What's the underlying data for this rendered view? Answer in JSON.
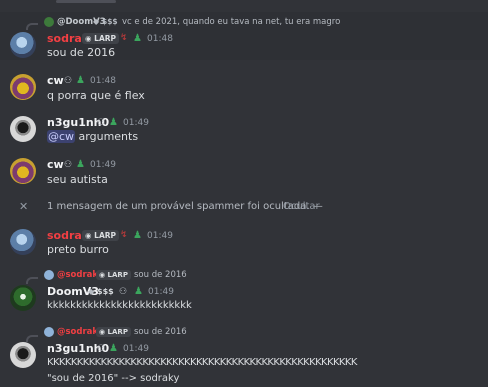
{
  "colors": {
    "background": "#313338",
    "accent_red": "#f23f43",
    "muted": "#949ba4",
    "mention_bg": "#3c4270",
    "mention_fg": "#c9cdfb"
  },
  "messages": {
    "m1": {
      "reply_author": "@DoomV3",
      "reply_tag": "$$$",
      "reply_text": "vc e de 2021, quando eu tava na net, tu era magro",
      "author": "sodraky",
      "tag": "LARP",
      "time": "01:48",
      "text": "sou de 2016"
    },
    "m2": {
      "author": "cw",
      "time": "01:48",
      "text": "q porra que é flex"
    },
    "m3": {
      "author": "n3gu1nh0",
      "time": "01:49",
      "mention": "@cw",
      "text": " arguments"
    },
    "m4": {
      "author": "cw",
      "time": "01:49",
      "text": "seu autista"
    },
    "spam_notice": {
      "text": "1 mensagem de um provável spammer foi ocultada. —",
      "action": "Ocultar"
    },
    "m5": {
      "author": "sodraky",
      "tag": "LARP",
      "time": "01:49",
      "text": "preto burro"
    },
    "m6": {
      "reply_author": "@sodraky",
      "reply_tag": "LARP",
      "reply_text": "sou de 2016",
      "author": "DoomV3",
      "tag": "$$$",
      "time": "01:49",
      "text": "kkkkkkkkkkkkkkkkkkkkkkkkk"
    },
    "m7": {
      "reply_author": "@sodraky",
      "reply_tag": "LARP",
      "reply_text": "sou de 2016",
      "author": "n3gu1nh0",
      "time": "01:49",
      "text": "KKKKKKKKKKKKKKKKKKKKKKKKKKKKKKKKKKKKKKKKKKKKKKKKKKKK",
      "text2": "\"sou de 2016\" --> sodraky"
    }
  }
}
